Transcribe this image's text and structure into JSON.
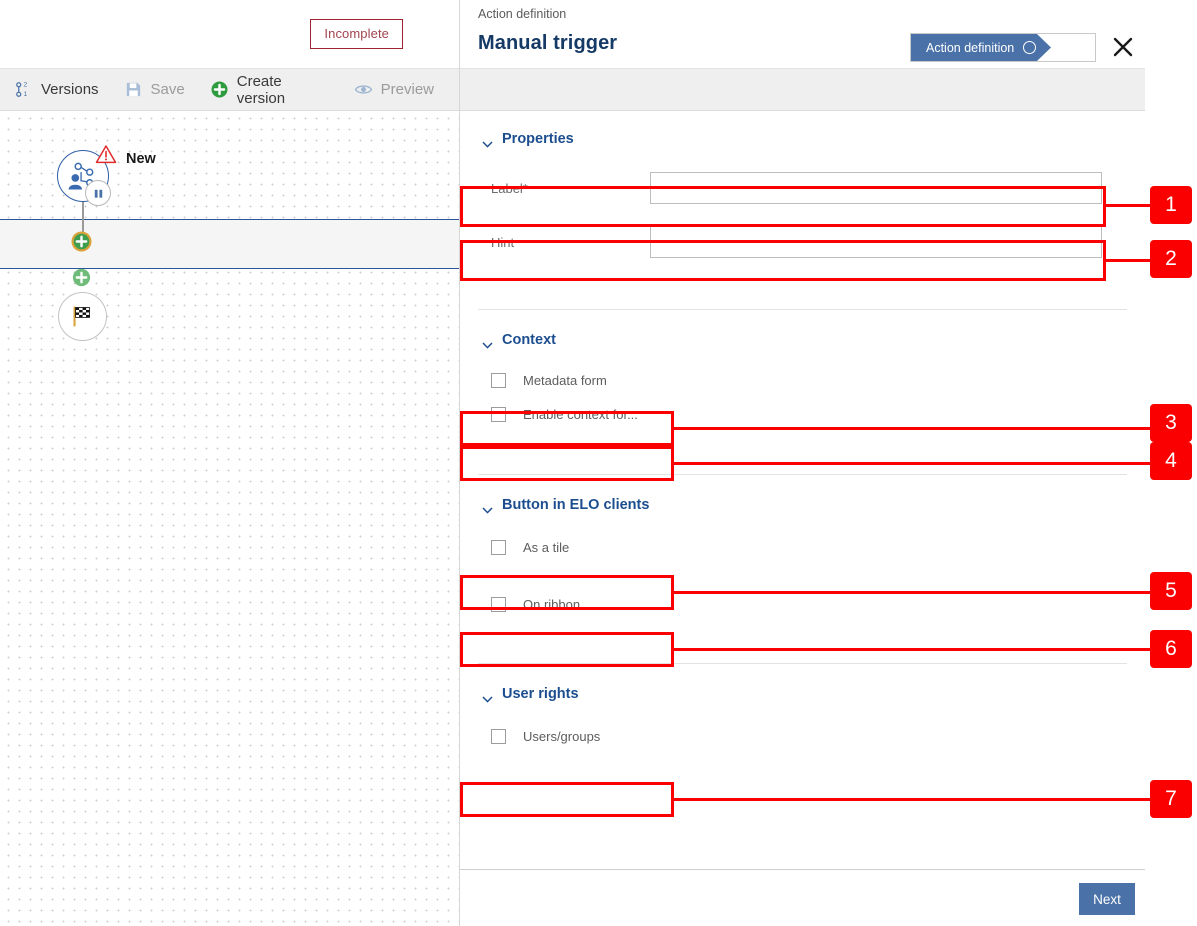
{
  "left": {
    "status_badge": "Incomplete",
    "toolbar": [
      {
        "label": "Versions",
        "icon": "versions-icon",
        "disabled": false
      },
      {
        "label": "Save",
        "icon": "save-icon",
        "disabled": true
      },
      {
        "label": "Create version",
        "icon": "plus-circle-icon",
        "disabled": false
      },
      {
        "label": "Preview",
        "icon": "eye-icon",
        "disabled": true
      }
    ],
    "workflow": {
      "start_node_label": "New",
      "start_node_icon": "org-chart-user-icon",
      "warning_icon": "warning-triangle-icon",
      "pause_icon": "pause-icon",
      "add_node_icon": "plus-circle-icon",
      "end_node_icon": "checkered-flag-icon"
    }
  },
  "right": {
    "breadcrumb": "Action definition",
    "title": "Manual trigger",
    "step_chip": "Action definition",
    "close_icon": "close-icon",
    "sections": {
      "properties": {
        "heading": "Properties",
        "fields": [
          {
            "label": "Label*",
            "value": "",
            "placeholder": ""
          },
          {
            "label": "Hint",
            "value": "",
            "placeholder": ""
          }
        ]
      },
      "context": {
        "heading": "Context",
        "checkboxes": [
          {
            "label": "Metadata form",
            "checked": false
          },
          {
            "label": "Enable context for...",
            "checked": false
          }
        ]
      },
      "button_in_elo_clients": {
        "heading": "Button in ELO clients",
        "checkboxes": [
          {
            "label": "As a tile",
            "checked": false
          },
          {
            "label": "On ribbon",
            "checked": false
          }
        ]
      },
      "user_rights": {
        "heading": "User rights",
        "checkboxes": [
          {
            "label": "Users/groups",
            "checked": false
          }
        ]
      }
    },
    "next_button": "Next"
  },
  "annotations": {
    "numbers": [
      "1",
      "2",
      "3",
      "4",
      "5",
      "6",
      "7"
    ]
  },
  "colors": {
    "accent_blue": "#4a72a8",
    "heading_blue": "#1c4e8f",
    "annotation_red": "#fb0000",
    "status_red": "#a02334",
    "green": "#2e9b3e"
  }
}
